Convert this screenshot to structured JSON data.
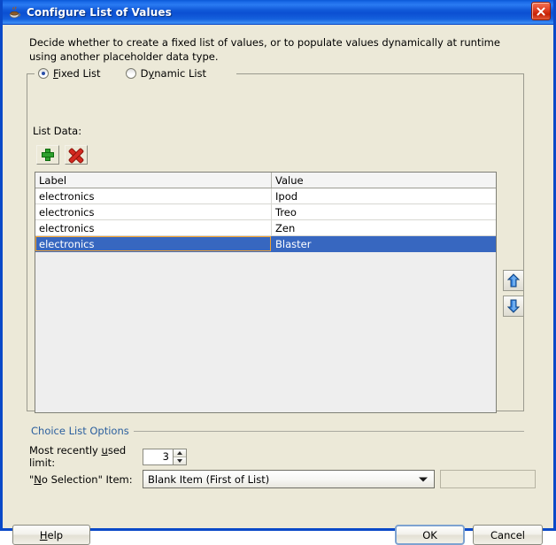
{
  "window": {
    "title": "Configure List of Values",
    "icon": "java-coffee-cup-icon",
    "close_label": "✕",
    "border_color": "#0a49c8",
    "titlebar_color": "#1159d9"
  },
  "description": "Decide whether to create a fixed list of values, or to populate values dynamically at runtime using another placeholder data type.",
  "list_type": {
    "options": [
      {
        "label": "Fixed List",
        "mnemonic": "F",
        "selected": true
      },
      {
        "label": "Dynamic List",
        "mnemonic": "y",
        "selected": false
      }
    ]
  },
  "list_data": {
    "label": "List Data:",
    "toolbar": [
      {
        "name": "add-button",
        "icon": "plus-icon",
        "tooltip": "Add"
      },
      {
        "name": "delete-button",
        "icon": "delete-x-icon",
        "tooltip": "Delete"
      }
    ],
    "columns": [
      "Label",
      "Value"
    ],
    "rows": [
      {
        "label": "electronics",
        "value": "Ipod",
        "selected": false
      },
      {
        "label": "electronics",
        "value": "Treo",
        "selected": false
      },
      {
        "label": "electronics",
        "value": "Zen",
        "selected": false
      },
      {
        "label": "electronics",
        "value": "Blaster",
        "selected": true
      }
    ],
    "selection_color": "#3767c0",
    "focus_outline_color": "#f0a030"
  },
  "reorder": [
    {
      "name": "move-up-button",
      "icon": "arrow-up-icon"
    },
    {
      "name": "move-down-button",
      "icon": "arrow-down-icon"
    }
  ],
  "choice_list_options": {
    "section_title": "Choice List Options",
    "section_title_color": "#2b5f9e",
    "mru": {
      "label_prefix": "Most recently ",
      "label_mnemonic": "u",
      "label_suffix": "sed limit:",
      "value": "3"
    },
    "no_selection": {
      "label_prefix": "\"",
      "label_mnemonic": "N",
      "label_suffix": "o Selection\" Item:",
      "selected_option": "Blank Item (First of List)",
      "options": [
        "Blank Item (First of List)"
      ],
      "extra_field_value": ""
    }
  },
  "buttons": {
    "help": {
      "text": "Help",
      "mnemonic": "H"
    },
    "ok": {
      "text": "OK",
      "default": true
    },
    "cancel": {
      "text": "Cancel"
    }
  }
}
